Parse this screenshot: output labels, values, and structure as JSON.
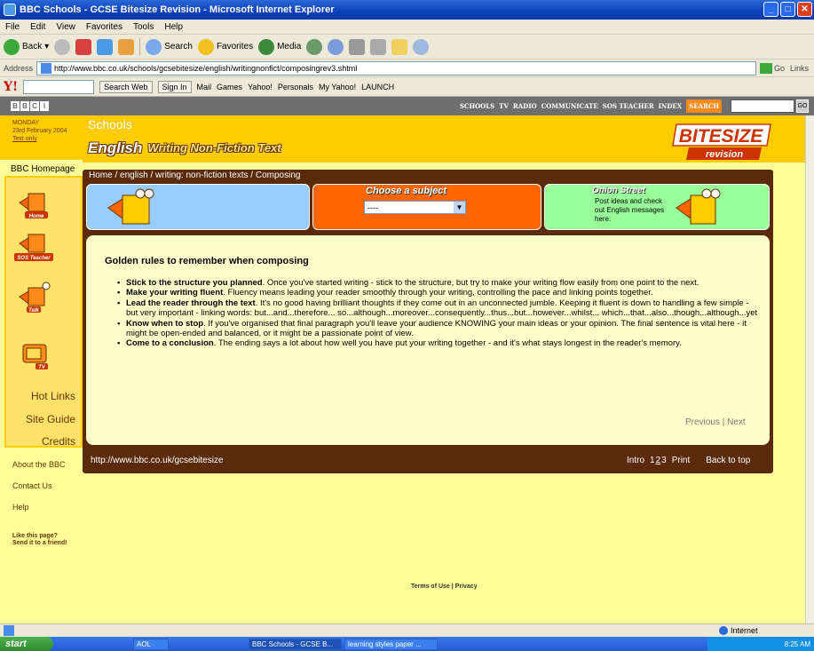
{
  "window": {
    "title": "BBC Schools - GCSE Bitesize Revision - Microsoft Internet Explorer"
  },
  "menu": [
    "File",
    "Edit",
    "View",
    "Favorites",
    "Tools",
    "Help"
  ],
  "toolbar": {
    "back": "Back",
    "search": "Search",
    "favorites": "Favorites",
    "media": "Media"
  },
  "address": {
    "label": "Address",
    "url": "http://www.bbc.co.uk/schools/gcsebitesize/english/writingnonfict/composingrev3.shtml",
    "go": "Go",
    "links": "Links"
  },
  "yahoo": {
    "search_btn": "Search Web",
    "signin": "Sign In",
    "items": [
      "Mail",
      "Games",
      "Yahoo!",
      "Personals",
      "My Yahoo!",
      "LAUNCH"
    ]
  },
  "bbc": {
    "logo": [
      "B",
      "B",
      "C",
      "i"
    ],
    "nav": [
      "SCHOOLS",
      "TV",
      "RADIO",
      "COMMUNICATE",
      "SOS TEACHER",
      "INDEX"
    ],
    "search": "SEARCH",
    "go": "GO"
  },
  "date": {
    "day": "MONDAY",
    "date": "23rd February 2004",
    "textonly": "Text only"
  },
  "left": {
    "home": "BBC Homepage",
    "nav_icons": [
      "Home",
      "SOS Teacher",
      "Talk",
      "TV"
    ],
    "links": [
      "Hot Links",
      "Site Guide",
      "Credits"
    ],
    "about": "About the BBC",
    "contact": "Contact Us",
    "help": "Help",
    "like": "Like this page?",
    "send": "Send it to a friend!"
  },
  "header": {
    "schools": "Schools",
    "english": "English",
    "subtitle": "Writing Non-Fiction Text",
    "bitesize": "BITESIZE",
    "revision": "revision"
  },
  "breadcrumb": "Home / english / writing: non-fiction texts / Composing",
  "choose": {
    "title": "Choose a subject",
    "selected": "----"
  },
  "onion": {
    "title": "Onion Street",
    "text": "Post ideas and check out English messages here."
  },
  "content": {
    "title": "Golden rules to remember when composing",
    "rules": [
      {
        "bold": "Stick to the structure you planned",
        "text": ". Once you've started writing - stick to the structure, but try to make your writing flow easily from one point to the next."
      },
      {
        "bold": "Make your writing fluent",
        "text": ". Fluency means leading your reader smoothly through your writing, controlling the pace and linking points together."
      },
      {
        "bold": "Lead the reader through the text",
        "text": ". It's no good having brilliant thoughts if they come out in an unconnected jumble. Keeping it fluent is down to handling a few simple - but very important - linking words: but...and...therefore... so...although...moreover...consequently...thus...but...however...whilst... which...that...also...though...although...yet"
      },
      {
        "bold": "Know when to stop",
        "text": ". If you've organised that final paragraph you'll leave your audience KNOWING your main ideas or your opinion. The final sentence is vital here - it might be open-ended and balanced, or it might be a passionate point of view."
      },
      {
        "bold": "Come to a conclusion",
        "text": ". The ending says a lot about how well you have put your writing together - and it's what stays longest in the reader's memory."
      }
    ],
    "previous": "Previous",
    "pipe": "|",
    "next": "Next"
  },
  "footer": {
    "url": "http://www.bbc.co.uk/gcsebitesize",
    "intro": "Intro",
    "pages": [
      "1",
      "2",
      "3"
    ],
    "print": "Print",
    "back_to_top": "Back to top",
    "terms": "Terms of Use | Privacy"
  },
  "status": {
    "zone": "Internet"
  },
  "taskbar": {
    "start": "start",
    "items": [
      "AOL",
      "BBC Schools - GCSE B...",
      "learning styles paper ..."
    ],
    "time": "8:25 AM"
  }
}
